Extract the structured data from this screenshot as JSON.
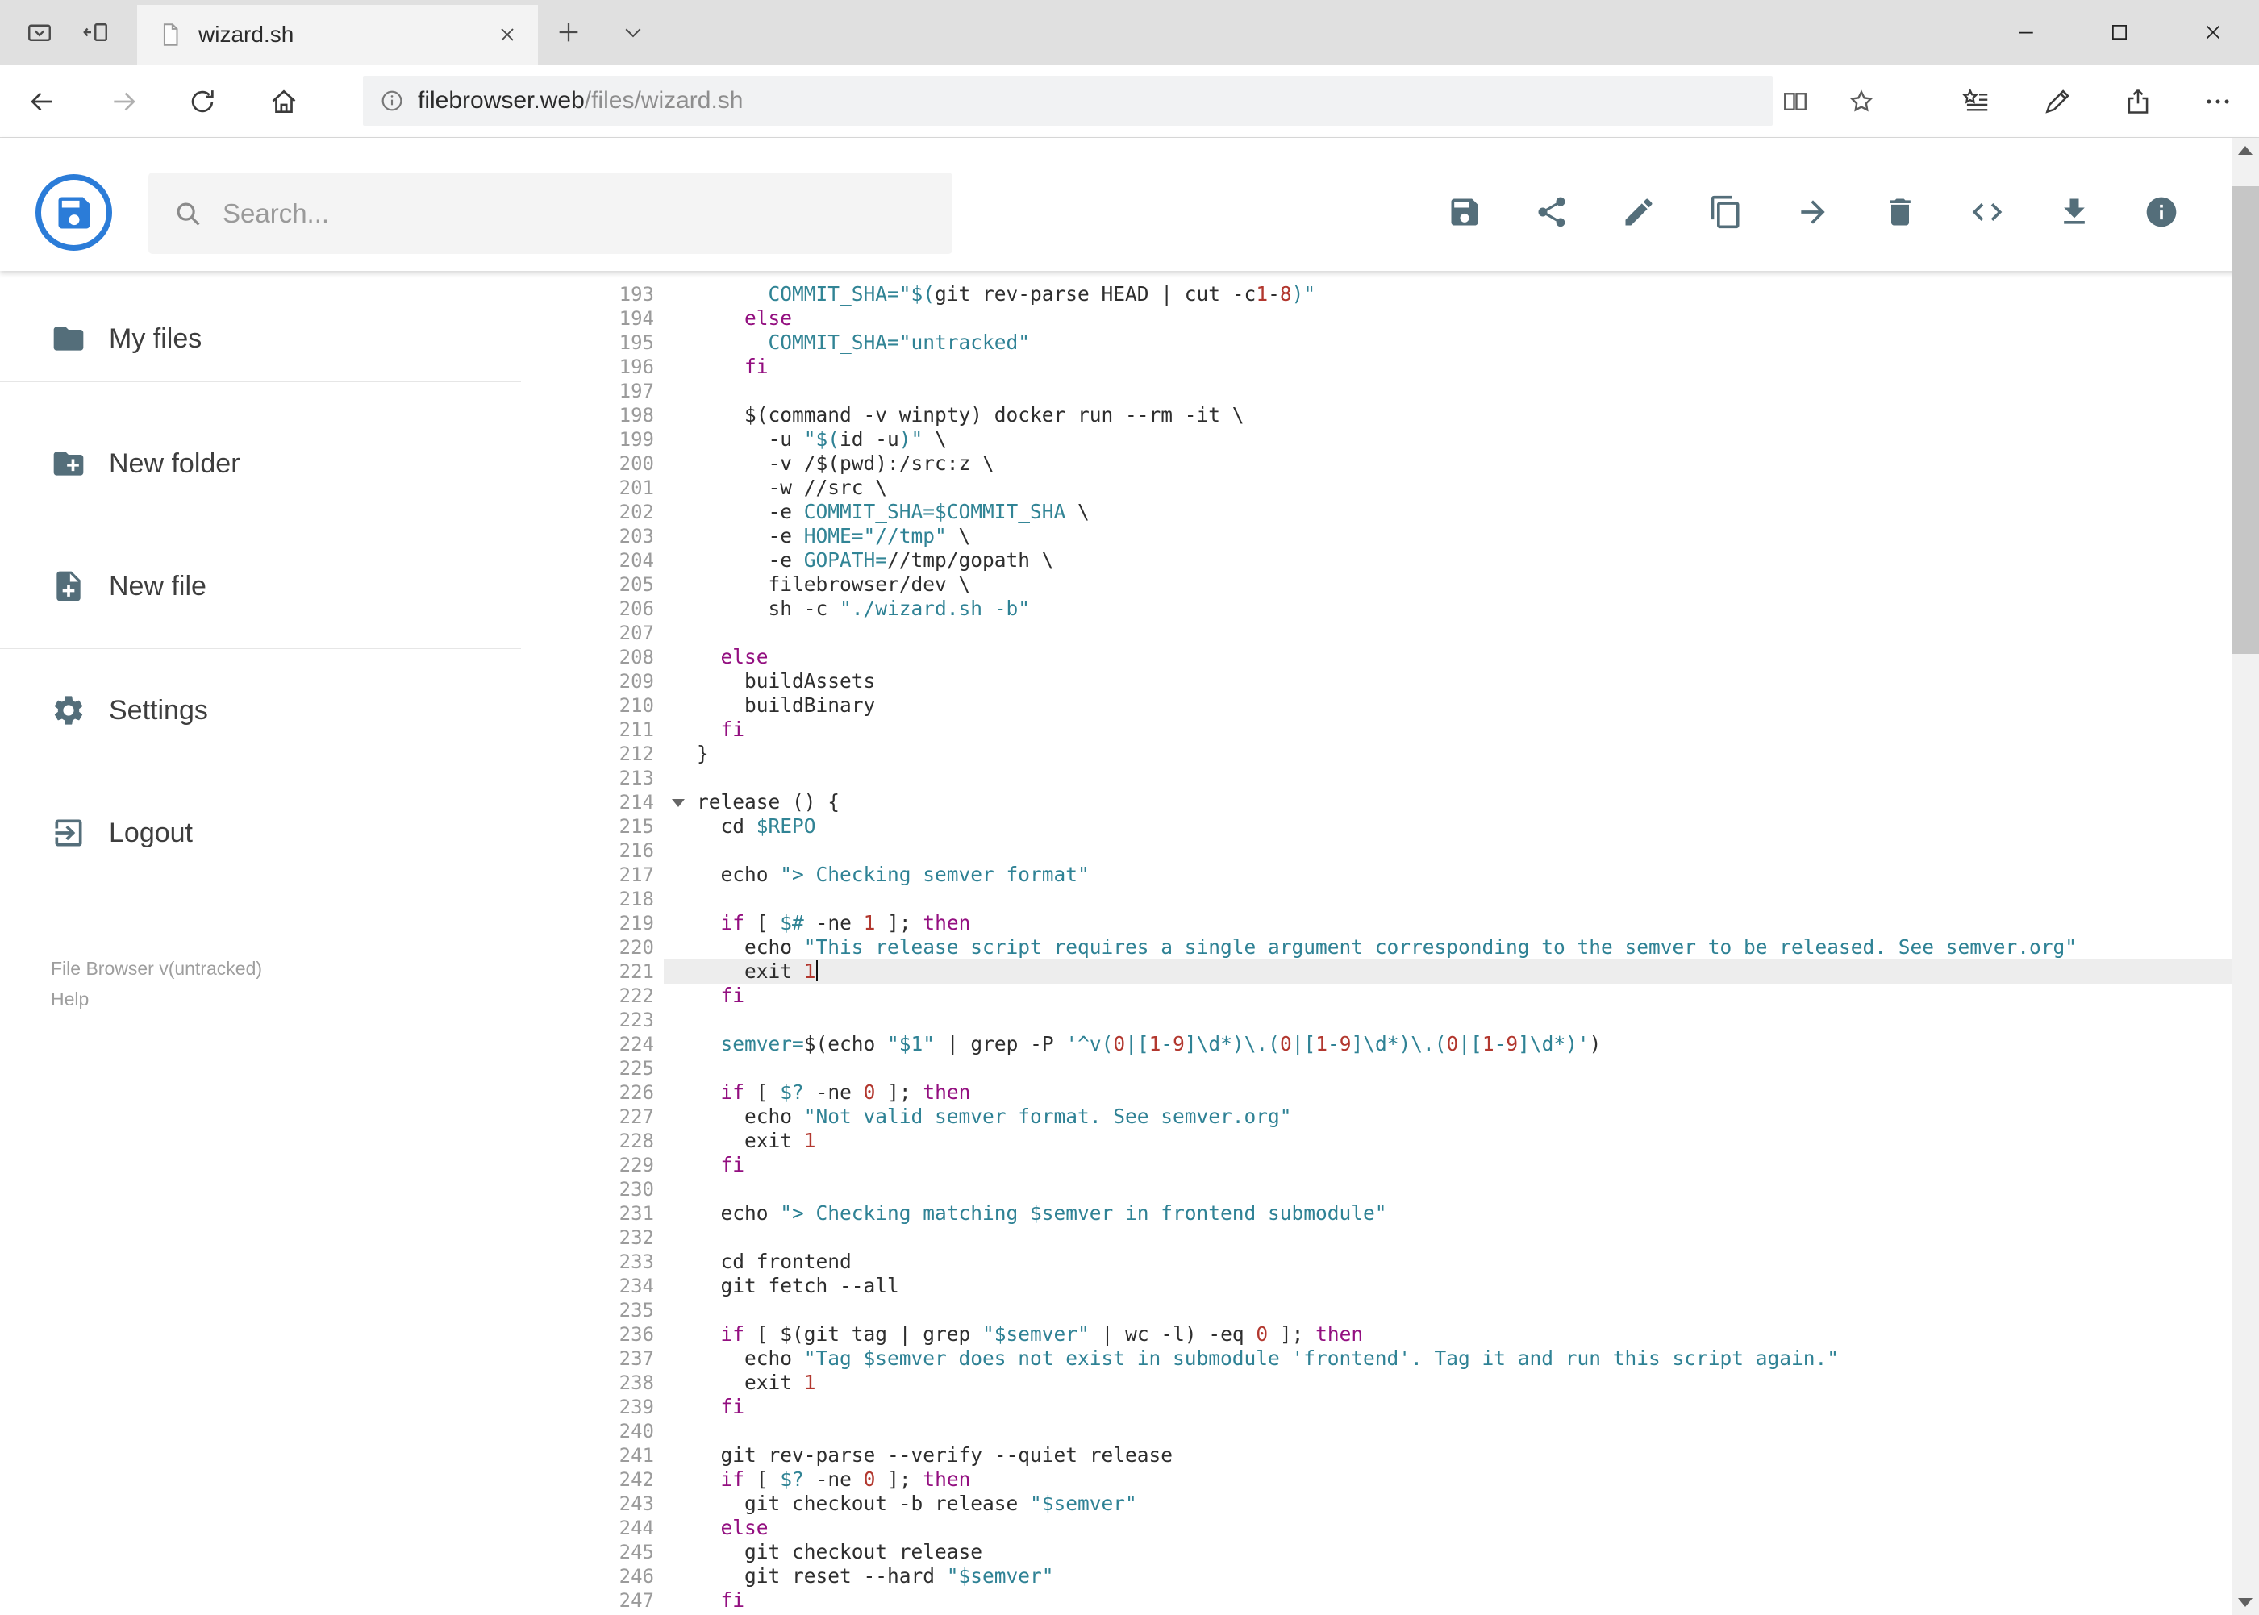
{
  "browser": {
    "tab_title": "wizard.sh",
    "url_host": "filebrowser.web",
    "url_path": "/files/wizard.sh",
    "nav_icons": [
      "back",
      "forward",
      "refresh",
      "home"
    ],
    "address_icons": [
      "info",
      "reading-view",
      "favorite-star"
    ],
    "toolbar_icons": [
      "hub",
      "web-note",
      "share",
      "more"
    ],
    "window_controls": [
      "minimize",
      "maximize",
      "close"
    ]
  },
  "header": {
    "search_placeholder": "Search...",
    "accent_color": "#2B7CD8",
    "action_icons": [
      "save",
      "share",
      "rename",
      "copy",
      "move",
      "delete",
      "raw-viewer",
      "download",
      "info"
    ]
  },
  "sidebar": {
    "items": [
      {
        "icon": "folder-icon",
        "label": "My files"
      },
      {
        "icon": "new-folder-icon",
        "label": "New folder"
      },
      {
        "icon": "new-file-icon",
        "label": "New file"
      },
      {
        "icon": "settings-icon",
        "label": "Settings"
      },
      {
        "icon": "logout-icon",
        "label": "Logout"
      }
    ],
    "footer_version": "File Browser v(untracked)",
    "footer_help": "Help"
  },
  "editor": {
    "language": "shell",
    "first_line_number": 193,
    "active_line": 221,
    "cursor_line": 221,
    "fold_lines": [
      214
    ],
    "colors": {
      "keyword": "#930F80",
      "string": "#2F8295",
      "variable": "#318495",
      "number": "#B2372E",
      "text": "#2E2E2E",
      "line_number": "#9B9B9B",
      "active_line_bg": "#EDEDED"
    },
    "lines": [
      "      COMMIT_SHA=\"$(git rev-parse HEAD | cut -c1-8)\"",
      "    else",
      "      COMMIT_SHA=\"untracked\"",
      "    fi",
      "",
      "    $(command -v winpty) docker run --rm -it \\",
      "      -u \"$(id -u)\" \\",
      "      -v /$(pwd):/src:z \\",
      "      -w //src \\",
      "      -e COMMIT_SHA=$COMMIT_SHA \\",
      "      -e HOME=\"//tmp\" \\",
      "      -e GOPATH=//tmp/gopath \\",
      "      filebrowser/dev \\",
      "      sh -c \"./wizard.sh -b\"",
      "",
      "  else",
      "    buildAssets",
      "    buildBinary",
      "  fi",
      "}",
      "",
      "release () {",
      "  cd $REPO",
      "",
      "  echo \"> Checking semver format\"",
      "",
      "  if [ $# -ne 1 ]; then",
      "    echo \"This release script requires a single argument corresponding to the semver to be released. See semver.org\"",
      "    exit 1",
      "  fi",
      "",
      "  semver=$(echo \"$1\" | grep -P '^v(0|[1-9]\\d*)\\.(0|[1-9]\\d*)\\.(0|[1-9]\\d*)')",
      "",
      "  if [ $? -ne 0 ]; then",
      "    echo \"Not valid semver format. See semver.org\"",
      "    exit 1",
      "  fi",
      "",
      "  echo \"> Checking matching $semver in frontend submodule\"",
      "",
      "  cd frontend",
      "  git fetch --all",
      "",
      "  if [ $(git tag | grep \"$semver\" | wc -l) -eq 0 ]; then",
      "    echo \"Tag $semver does not exist in submodule 'frontend'. Tag it and run this script again.\"",
      "    exit 1",
      "  fi",
      "",
      "  git rev-parse --verify --quiet release",
      "  if [ $? -ne 0 ]; then",
      "    git checkout -b release \"$semver\"",
      "  else",
      "    git checkout release",
      "    git reset --hard \"$semver\"",
      "  fi"
    ]
  }
}
